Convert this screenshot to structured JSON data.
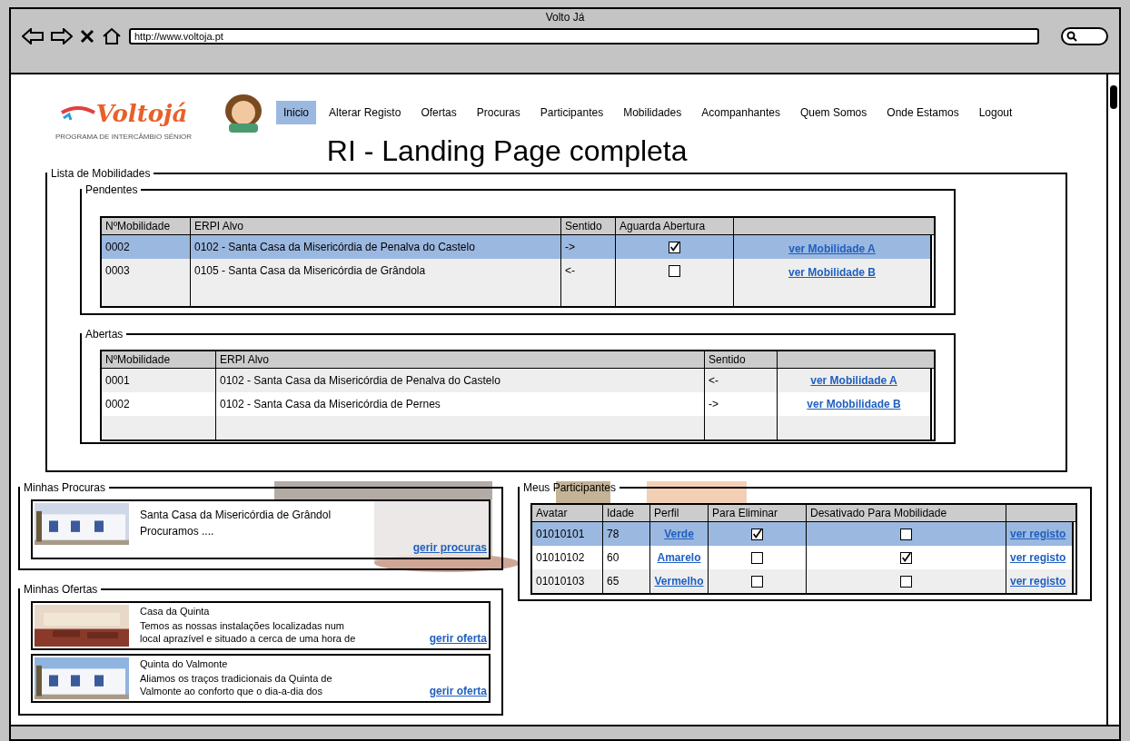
{
  "window": {
    "title": "Volto Já"
  },
  "browser": {
    "url": "http://www.voltoja.pt"
  },
  "header": {
    "logo": "Voltojá",
    "tagline": "PROGRAMA DE INTERCÂMBIO SÉNIOR",
    "title": "RI - Landing Page completa"
  },
  "nav": [
    {
      "label": "Inicio",
      "selected": true
    },
    {
      "label": "Alterar Registo",
      "selected": false
    },
    {
      "label": "Ofertas",
      "selected": false
    },
    {
      "label": "Procuras",
      "selected": false
    },
    {
      "label": "Participantes",
      "selected": false
    },
    {
      "label": "Mobilidades",
      "selected": false
    },
    {
      "label": "Acompanhantes",
      "selected": false
    },
    {
      "label": "Quem Somos",
      "selected": false
    },
    {
      "label": "Onde Estamos",
      "selected": false
    },
    {
      "label": "Logout",
      "selected": false
    }
  ],
  "lista_mobilidades": {
    "title": "Lista de Mobilidades",
    "pendentes": {
      "title": "Pendentes",
      "columns": [
        "NºMobilidade",
        "ERPI Alvo",
        "Sentido",
        "Aguarda Abertura"
      ],
      "rows": [
        {
          "numero": "0002",
          "erpi": "0102 - Santa Casa da Misericórdia de Penalva do Castelo",
          "sentido": "->",
          "aguarda_abertura": true,
          "link": "ver Mobilidade A",
          "selected": true
        },
        {
          "numero": "0003",
          "erpi": "0105 - Santa Casa da Misericórdia de Grândola",
          "sentido": "<-",
          "aguarda_abertura": false,
          "link": "ver Mobilidade B",
          "selected": false
        }
      ]
    },
    "abertas": {
      "title": "Abertas",
      "columns": [
        "NºMobilidade",
        "ERPI Alvo",
        "Sentido"
      ],
      "rows": [
        {
          "numero": "0001",
          "erpi": "0102 - Santa Casa da Misericórdia de Penalva do Castelo",
          "sentido": "<-",
          "link": "ver Mobilidade A",
          "selected": false
        },
        {
          "numero": "0002",
          "erpi": "0102 - Santa Casa da Misericórdia de Pernes",
          "sentido": "->",
          "link": "ver Mobbilidade B",
          "selected": false
        }
      ]
    }
  },
  "minhas_procuras": {
    "title": "Minhas Procuras",
    "items": [
      {
        "title": "Santa Casa da Misericórdia de Grândol",
        "text": "Procuramos ....",
        "link": "gerir procuras"
      }
    ]
  },
  "minhas_ofertas": {
    "title": "Minhas Ofertas",
    "items": [
      {
        "title": "Casa da Quinta",
        "lines": [
          "Temos as nossas instalações localizadas num",
          "local aprazível e situado a cerca de uma hora de"
        ],
        "link": "gerir oferta"
      },
      {
        "title": "Quinta do Valmonte",
        "lines": [
          "Aliamos os traços tradicionais da Quinta de",
          "Valmonte ao conforto que o dia-a-dia dos"
        ],
        "link": "gerir oferta"
      }
    ]
  },
  "meus_participantes": {
    "title": "Meus Participantes",
    "columns": [
      "Avatar",
      "Idade",
      "Perfil",
      "Para Eliminar",
      "Desativado Para Mobilidade"
    ],
    "rows": [
      {
        "avatar": "01010101",
        "idade": "78",
        "perfil": "Verde",
        "para_eliminar": true,
        "desativado": false,
        "link": "ver registo",
        "selected": true
      },
      {
        "avatar": "01010102",
        "idade": "60",
        "perfil": "Amarelo",
        "para_eliminar": false,
        "desativado": true,
        "link": "ver registo",
        "selected": false
      },
      {
        "avatar": "01010103",
        "idade": "65",
        "perfil": "Vermelho",
        "para_eliminar": false,
        "desativado": false,
        "link": "ver registo",
        "selected": false
      }
    ]
  }
}
